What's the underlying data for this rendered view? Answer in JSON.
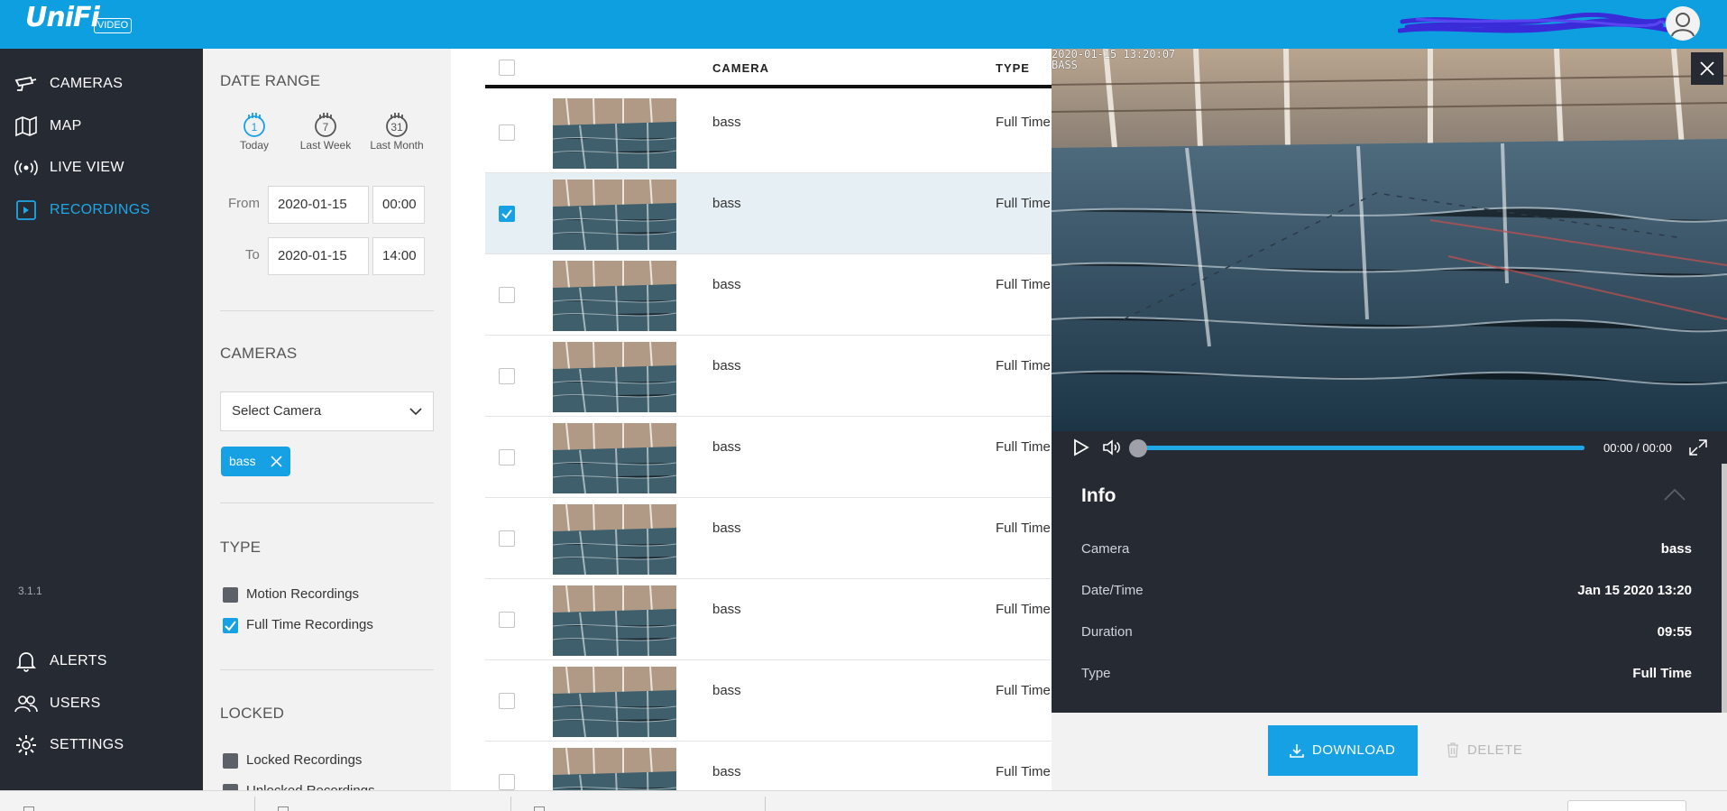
{
  "app": {
    "logo_text": "UniFi",
    "logo_badge": "VIDEO",
    "version": "3.1.1"
  },
  "nav": {
    "top_items": [
      {
        "label": "CAMERAS",
        "icon": "camera-icon"
      },
      {
        "label": "MAP",
        "icon": "map-icon"
      },
      {
        "label": "LIVE VIEW",
        "icon": "live-view-icon"
      },
      {
        "label": "RECORDINGS",
        "icon": "recordings-icon",
        "active": true
      }
    ],
    "bottom_items": [
      {
        "label": "ALERTS",
        "icon": "bell-icon"
      },
      {
        "label": "USERS",
        "icon": "users-icon"
      },
      {
        "label": "SETTINGS",
        "icon": "gear-icon"
      }
    ]
  },
  "filters": {
    "date_range": {
      "title": "DATE RANGE",
      "quick": [
        {
          "label": "Today",
          "number": "1",
          "active": true
        },
        {
          "label": "Last Week",
          "number": "7"
        },
        {
          "label": "Last Month",
          "number": "31"
        }
      ],
      "from_label": "From",
      "from_date": "2020-01-15",
      "from_time": "00:00",
      "to_label": "To",
      "to_date": "2020-01-15",
      "to_time": "14:00"
    },
    "cameras": {
      "title": "CAMERAS",
      "select_placeholder": "Select Camera",
      "selected_tags": [
        "bass"
      ]
    },
    "type": {
      "title": "TYPE",
      "options": [
        {
          "label": "Motion Recordings",
          "checked": false
        },
        {
          "label": "Full Time Recordings",
          "checked": true
        }
      ]
    },
    "locked": {
      "title": "LOCKED",
      "options": [
        {
          "label": "Locked Recordings",
          "checked": false
        },
        {
          "label": "Unlocked Recordings",
          "checked": false
        }
      ]
    }
  },
  "table": {
    "columns": [
      "CAMERA",
      "TYPE"
    ],
    "rows": [
      {
        "camera": "bass",
        "type": "Full Time",
        "checked": false
      },
      {
        "camera": "bass",
        "type": "Full Time",
        "checked": true
      },
      {
        "camera": "bass",
        "type": "Full Time",
        "checked": false
      },
      {
        "camera": "bass",
        "type": "Full Time",
        "checked": false
      },
      {
        "camera": "bass",
        "type": "Full Time",
        "checked": false
      },
      {
        "camera": "bass",
        "type": "Full Time",
        "checked": false
      },
      {
        "camera": "bass",
        "type": "Full Time",
        "checked": false
      },
      {
        "camera": "bass",
        "type": "Full Time",
        "checked": false
      },
      {
        "camera": "bass",
        "type": "Full Time",
        "checked": false
      }
    ]
  },
  "player": {
    "osd_timestamp": "2020-01-15 13:20:07",
    "osd_camera": "BASS",
    "timer": "00:00 / 00:00",
    "progress": 0,
    "info": {
      "title": "Info",
      "rows": [
        {
          "key": "Camera",
          "value": "bass"
        },
        {
          "key": "Date/Time",
          "value": "Jan 15 2020 13:20"
        },
        {
          "key": "Duration",
          "value": "09:55"
        },
        {
          "key": "Type",
          "value": "Full Time"
        }
      ]
    },
    "download_label": "DOWNLOAD",
    "delete_label": "DELETE"
  },
  "colors": {
    "brand": "#0d9fe0",
    "accent": "#16a1e5",
    "nav_bg": "#262a33"
  }
}
